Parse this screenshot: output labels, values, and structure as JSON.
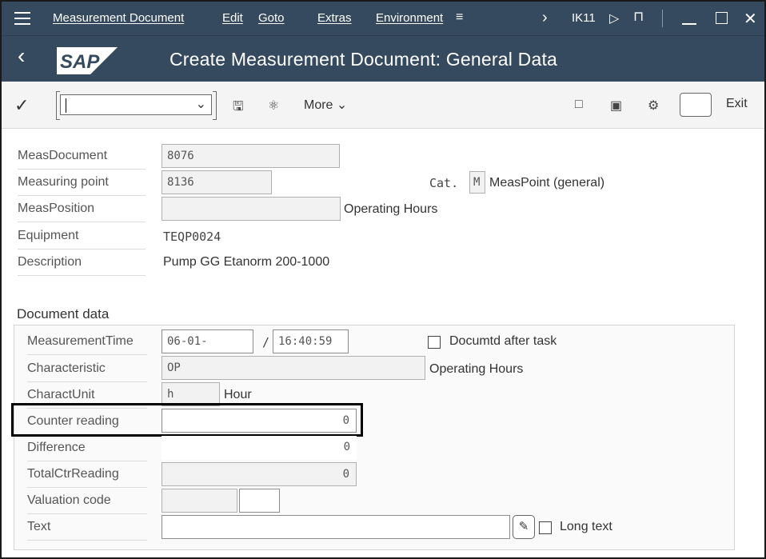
{
  "menubar": {
    "items": [
      "Measurement Document",
      "Edit",
      "Goto",
      "Extras",
      "Environment"
    ],
    "transaction": "IK11"
  },
  "titlebar": {
    "logo_text": "SAP",
    "title": "Create Measurement Document: General Data"
  },
  "toolbar": {
    "command_value": "",
    "more_label": "More",
    "exit_label": "Exit"
  },
  "header": {
    "meas_document_label": "MeasDocument",
    "meas_document_value": "8076",
    "measuring_point_label": "Measuring point",
    "measuring_point_value": "8136",
    "cat_label": "Cat.",
    "cat_value": "M",
    "cat_text": "MeasPoint (general)",
    "meas_position_label": "MeasPosition",
    "meas_position_value": "",
    "meas_position_text": "Operating Hours",
    "equipment_label": "Equipment",
    "equipment_value": "TEQP0024",
    "description_label": "Description",
    "description_value": "Pump GG Etanorm 200-1000"
  },
  "document_data": {
    "section_title": "Document data",
    "measurement_time_label": "MeasurementTime",
    "date_value": "06-01-",
    "date_separator": "/",
    "time_value": "16:40:59",
    "documented_after_task_label": "Documtd after task",
    "characteristic_label": "Characteristic",
    "characteristic_value": "OP",
    "characteristic_text": "Operating Hours",
    "charact_unit_label": "CharactUnit",
    "charact_unit_value": "h",
    "charact_unit_text": "Hour",
    "counter_reading_label": "Counter reading",
    "counter_reading_value": "0",
    "difference_label": "Difference",
    "difference_value": "0",
    "total_ctr_reading_label": "TotalCtrReading",
    "total_ctr_reading_value": "0",
    "valuation_code_label": "Valuation code",
    "valuation_code_value": "",
    "valuation_code_text": "",
    "text_label": "Text",
    "text_value": "",
    "long_text_label": "Long text"
  }
}
